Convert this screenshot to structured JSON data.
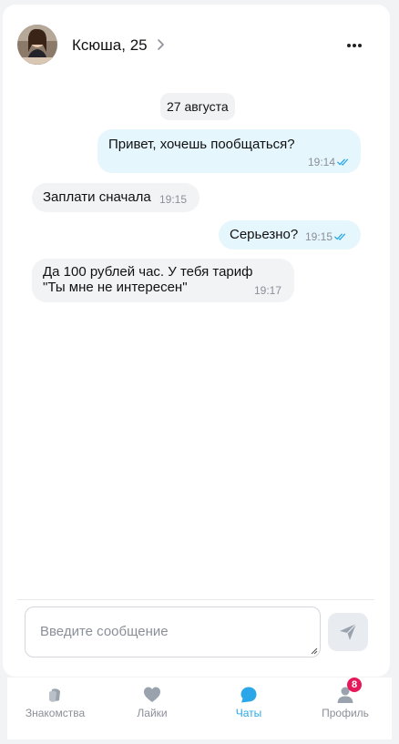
{
  "header": {
    "name": "Ксюша, 25"
  },
  "chat": {
    "date": "27 августа",
    "messages": [
      {
        "text": "Привет, хочешь пообщаться?",
        "time": "19:14",
        "direction": "outgoing",
        "read": true
      },
      {
        "text": "Заплати сначала",
        "time": "19:15",
        "direction": "incoming"
      },
      {
        "text": "Серьезно?",
        "time": "19:15",
        "direction": "outgoing",
        "read": true
      },
      {
        "text": "Да 100 рублей час. У тебя тариф \"Ты мне не интересен\"",
        "time": "19:17",
        "direction": "incoming"
      }
    ]
  },
  "composer": {
    "placeholder": "Введите сообщение",
    "value": ""
  },
  "tabbar": {
    "tabs": [
      {
        "label": "Знакомства",
        "icon": "dating-icon",
        "active": false
      },
      {
        "label": "Лайки",
        "icon": "heart-icon",
        "active": false
      },
      {
        "label": "Чаты",
        "icon": "chat-icon",
        "active": true
      },
      {
        "label": "Профиль",
        "icon": "profile-icon",
        "active": false,
        "badge": "8"
      }
    ]
  },
  "colors": {
    "accent": "#2aa7e8",
    "outgoing_bubble": "#e6f6fd",
    "incoming_bubble": "#f2f3f5",
    "badge": "#e5195a",
    "muted_text": "#8a8f98"
  }
}
